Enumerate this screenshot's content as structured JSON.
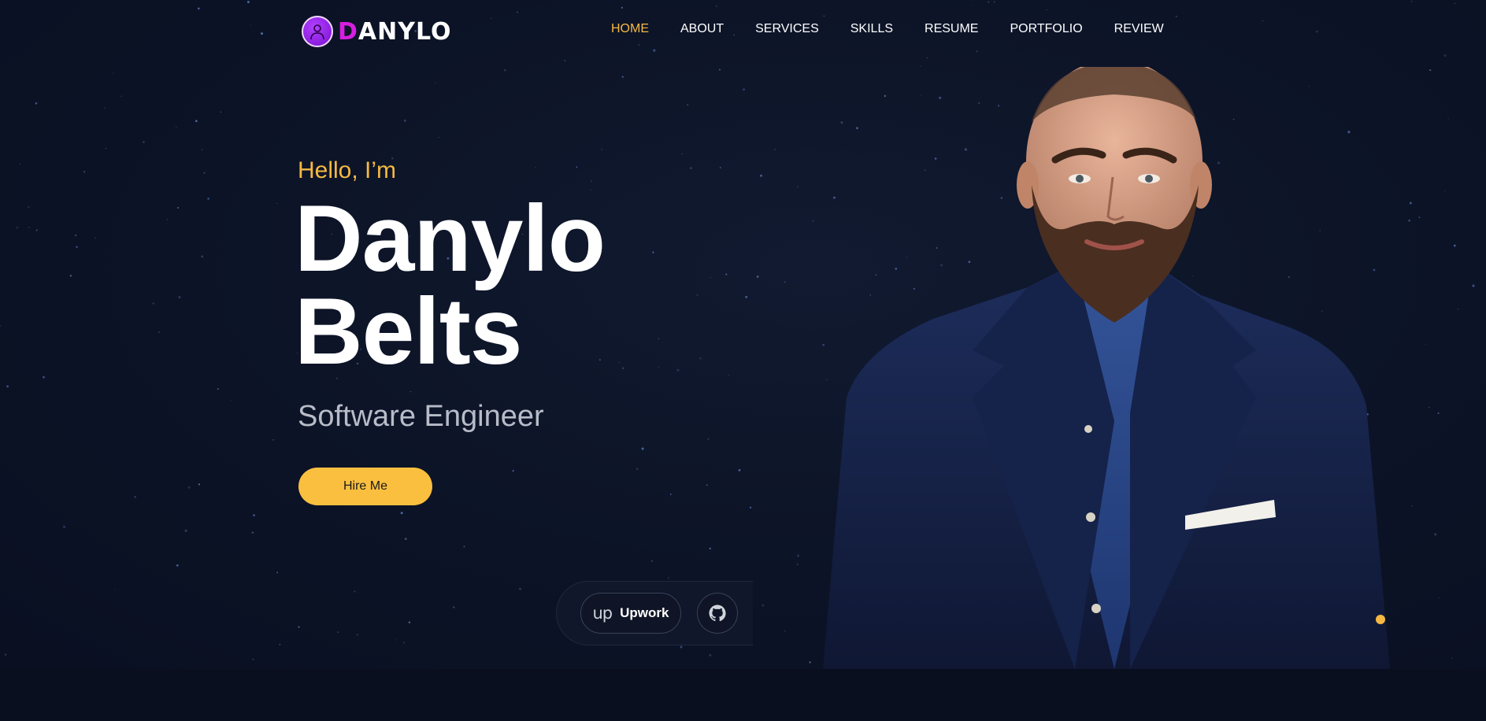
{
  "colors": {
    "background": "#0b1123",
    "accent": "#f5b942",
    "button": "#fbbf40",
    "logo_accent": "#d61fe0",
    "suit": "#1a2a55",
    "shirt": "#2a4a8a"
  },
  "header": {
    "logo": {
      "icon": "avatar-icon",
      "first_letter": "D",
      "rest": "ANYLO"
    },
    "nav": [
      {
        "label": "HOME",
        "active": true
      },
      {
        "label": "ABOUT",
        "active": false
      },
      {
        "label": "SERVICES",
        "active": false
      },
      {
        "label": "SKILLS",
        "active": false
      },
      {
        "label": "RESUME",
        "active": false
      },
      {
        "label": "PORTFOLIO",
        "active": false
      },
      {
        "label": "REVIEW",
        "active": false
      }
    ]
  },
  "hero": {
    "greeting": "Hello, I’m",
    "first_name": "Danylo",
    "last_name": "Belts",
    "role": "Software Engineer",
    "cta_label": "Hire Me",
    "portrait": "person-portrait"
  },
  "social": {
    "upwork": {
      "icon": "upwork-icon",
      "logo_text": "up",
      "label": "Upwork"
    },
    "github": {
      "icon": "github-icon"
    }
  }
}
